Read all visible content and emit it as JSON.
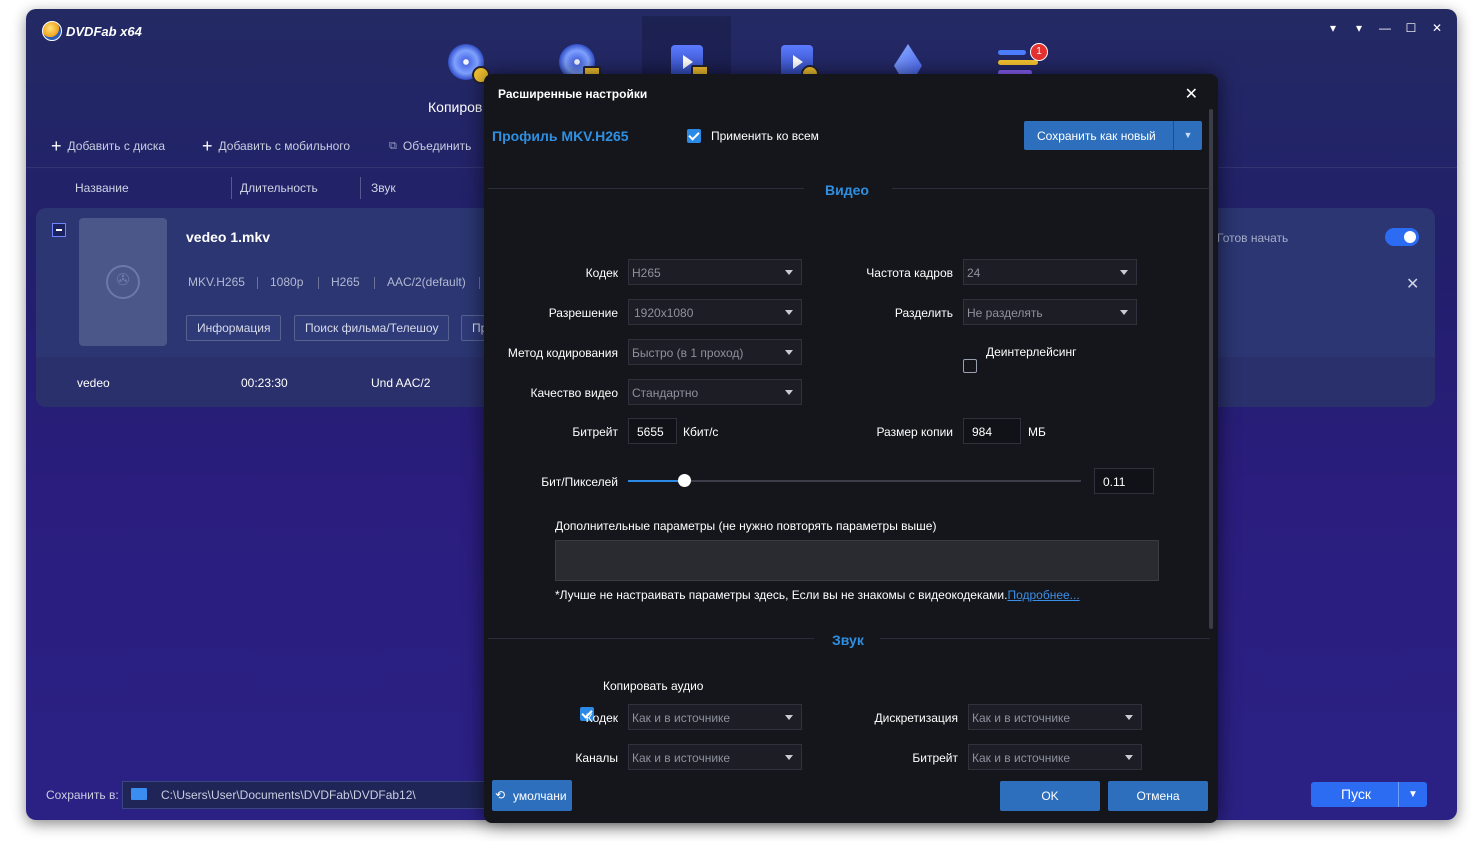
{
  "app": {
    "title": "DVDFab x64",
    "window_controls": [
      "▾",
      "▾",
      "—",
      "☐",
      "✕"
    ]
  },
  "modules": [
    {
      "label": "Копиров",
      "icon": "disc-copy-icon"
    },
    {
      "label": "",
      "icon": "disc-ripper-icon"
    },
    {
      "label": "",
      "icon": "video-converter-icon"
    },
    {
      "label": "",
      "icon": "video-creator-icon"
    },
    {
      "label": "",
      "icon": "launch-center-icon"
    },
    {
      "label": "",
      "icon": "task-queue-icon",
      "badge": "1"
    }
  ],
  "toolbar": {
    "add_disc": "Добавить с диска",
    "add_mobile": "Добавить с мобильного",
    "merge": "Объединить"
  },
  "columns": [
    "Название",
    "Длительность",
    "Звук"
  ],
  "file": {
    "name": "vedeo 1.mkv",
    "meta": [
      "MKV.H265",
      "1080p",
      "H265",
      "AAC/2(default)"
    ],
    "buttons": [
      "Информация",
      "Поиск фильма/Телешоу",
      "Пр"
    ],
    "status": "Готов начать",
    "title_row": {
      "name": "vedeo",
      "duration": "00:23:30",
      "audio": "Und AAC/2"
    }
  },
  "bottom": {
    "save_label": "Сохранить в:",
    "path": "C:\\Users\\User\\Documents\\DVDFab\\DVDFab12\\",
    "start": "Пуск"
  },
  "dialog": {
    "title": "Расширенные настройки",
    "profile": "Профиль  MKV.H265",
    "apply_all": "Применить ко всем",
    "save_new": "Сохранить как новый",
    "video_section": "Видео",
    "video": {
      "codec_label": "Кодек",
      "codec": "H265",
      "fps_label": "Частота кадров",
      "fps": "24",
      "resolution_label": "Разрешение",
      "resolution": "1920x1080",
      "split_label": "Разделить",
      "split": "Не разделять",
      "encode_label": "Метод кодирования",
      "encode": "Быстро (в 1 проход)",
      "deinterlace_label": "Деинтерлейсинг",
      "quality_label": "Качество видео",
      "quality": "Стандартно",
      "bitrate_label": "Битрейт",
      "bitrate": "5655",
      "bitrate_unit": "Кбит/с",
      "copysize_label": "Размер копии",
      "copysize": "984",
      "copysize_unit": "МБ",
      "bpp_label": "Бит/Пикселей",
      "bpp": "0.11"
    },
    "extra_label": "Дополнительные параметры (не нужно повторять параметры выше)",
    "note": "*Лучше не настраивать параметры здесь, Если вы не знакомы с видеокодеками.",
    "note_link": "Подробнее...",
    "audio_section": "Звук",
    "audio": {
      "copy_audio": "Копировать аудио",
      "codec_label": "Кодек",
      "codec": "Как и в источнике",
      "sampling_label": "Дискретизация",
      "sampling": "Как и в источнике",
      "channels_label": "Каналы",
      "channels": "Как и в источнике",
      "bitrate_label": "Битрейт",
      "bitrate": "Как и в источнике"
    },
    "default_btn": "умолчани",
    "ok": "OK",
    "cancel": "Отмена"
  },
  "colors": {
    "accent": "#2a8ae6",
    "button": "#2d6fbd",
    "start": "#2b6cf2",
    "dialog_bg": "#15161c"
  }
}
